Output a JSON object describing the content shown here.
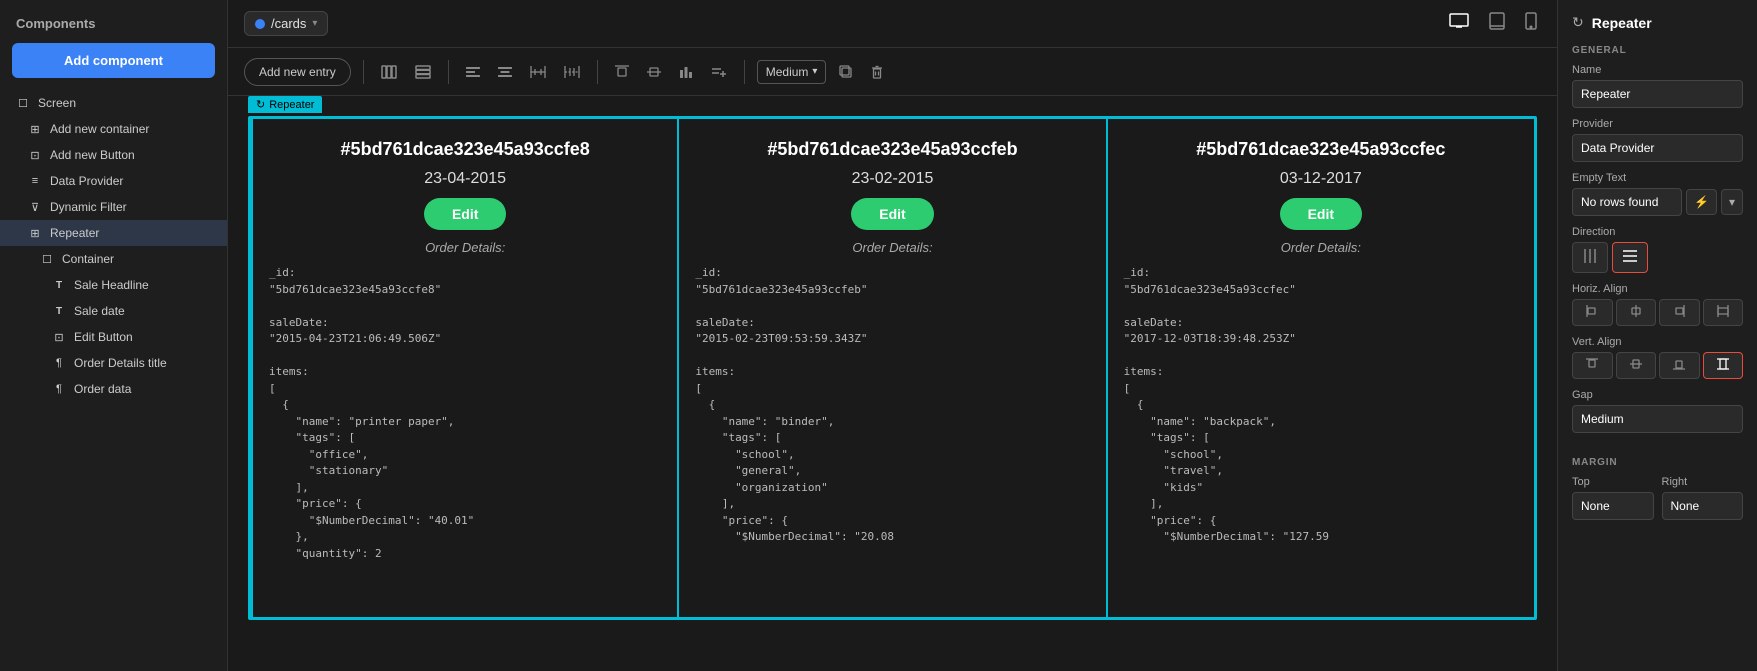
{
  "sidebar": {
    "title": "Components",
    "add_button": "Add component",
    "items": [
      {
        "id": "screen",
        "label": "Screen",
        "indent": 0,
        "icon": "☐"
      },
      {
        "id": "add-container",
        "label": "Add new container",
        "indent": 1,
        "icon": "⊞"
      },
      {
        "id": "add-button",
        "label": "Add new Button",
        "indent": 1,
        "icon": "⊡"
      },
      {
        "id": "data-provider",
        "label": "Data Provider",
        "indent": 1,
        "icon": "≡"
      },
      {
        "id": "dynamic-filter",
        "label": "Dynamic Filter",
        "indent": 1,
        "icon": "⊽"
      },
      {
        "id": "repeater",
        "label": "Repeater",
        "indent": 1,
        "icon": "⊞",
        "active": true
      },
      {
        "id": "container",
        "label": "Container",
        "indent": 2,
        "icon": "☐"
      },
      {
        "id": "sale-headline",
        "label": "Sale Headline",
        "indent": 3,
        "icon": "T"
      },
      {
        "id": "sale-date",
        "label": "Sale date",
        "indent": 3,
        "icon": "T"
      },
      {
        "id": "edit-button",
        "label": "Edit Button",
        "indent": 3,
        "icon": "⊡"
      },
      {
        "id": "order-details-title",
        "label": "Order Details title",
        "indent": 3,
        "icon": "¶"
      },
      {
        "id": "order-data",
        "label": "Order data",
        "indent": 3,
        "icon": "¶"
      }
    ]
  },
  "topbar": {
    "route": "/cards",
    "icons": {
      "desktop": "🖥",
      "tablet_h": "⬜",
      "mobile": "📱"
    }
  },
  "toolbar": {
    "add_entry": "Add new entry",
    "medium_label": "Medium"
  },
  "cards": [
    {
      "id": "#5bd761dcae323e45a93ccfe8",
      "date": "23-04-2015",
      "edit_label": "Edit",
      "order_details": "Order Details:",
      "data": "_id:\n\"5bd761dcae323e45a93ccfe8\"\n\nsaleDate:\n\"2015-04-23T21:06:49.506Z\"\n\nitems:\n[\n  {\n    \"name\": \"printer paper\",\n    \"tags\": [\n      \"office\",\n      \"stationary\"\n    ],\n    \"price\": {\n      \"$NumberDecimal\": \"40.01\"\n    },\n    \"quantity\": 2"
    },
    {
      "id": "#5bd761dcae323e45a93ccfeb",
      "date": "23-02-2015",
      "edit_label": "Edit",
      "order_details": "Order Details:",
      "data": "_id:\n\"5bd761dcae323e45a93ccfeb\"\n\nsaleDate:\n\"2015-02-23T09:53:59.343Z\"\n\nitems:\n[\n  {\n    \"name\": \"binder\",\n    \"tags\": [\n      \"school\",\n      \"general\",\n      \"organization\"\n    ],\n    \"price\": {\n      \"$NumberDecimal\": \"20.08"
    },
    {
      "id": "#5bd761dcae323e45a93ccfec",
      "date": "03-12-2017",
      "edit_label": "Edit",
      "order_details": "Order Details:",
      "data": "_id:\n\"5bd761dcae323e45a93ccfec\"\n\nsaleDate:\n\"2017-12-03T18:39:48.253Z\"\n\nitems:\n[\n  {\n    \"name\": \"backpack\",\n    \"tags\": [\n      \"school\",\n      \"travel\",\n      \"kids\"\n    ],\n    \"price\": {\n      \"$NumberDecimal\": \"127.59"
    }
  ],
  "right_panel": {
    "title": "Repeater",
    "icon": "↻",
    "general_section": "GENERAL",
    "name_label": "Name",
    "name_value": "Repeater",
    "provider_label": "Provider",
    "provider_value": "Data Provider",
    "empty_text_label": "Empty Text",
    "empty_text_value": "No rows found",
    "direction_label": "Direction",
    "direction_options": [
      "|||",
      "≡"
    ],
    "horiz_align_label": "Horiz. Align",
    "horiz_align_options": [
      "⊢",
      "⊣",
      "⊣⊢",
      "⊕"
    ],
    "vert_align_label": "Vert. Align",
    "vert_align_options": [
      "⊤",
      "⊥",
      "⊟",
      "⊕"
    ],
    "gap_label": "Gap",
    "gap_value": "Medium",
    "margin_section": "MARGIN",
    "top_label": "Top",
    "top_value": "None",
    "right_label": "Right",
    "right_value": "None"
  }
}
